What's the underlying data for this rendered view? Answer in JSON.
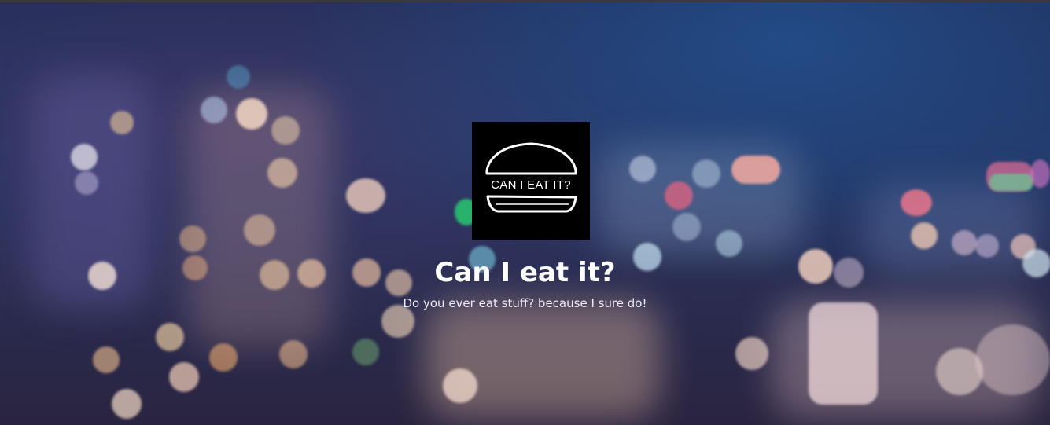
{
  "hero": {
    "logo_text": "CAN I EAT IT?",
    "title": "Can I eat it?",
    "subtitle": "Do you ever eat stuff? because I sure do!"
  },
  "colors": {
    "background": "#1c2340",
    "title": "#ffffff",
    "logo_background": "#000000"
  },
  "icons": {
    "logo": "burger-icon"
  }
}
